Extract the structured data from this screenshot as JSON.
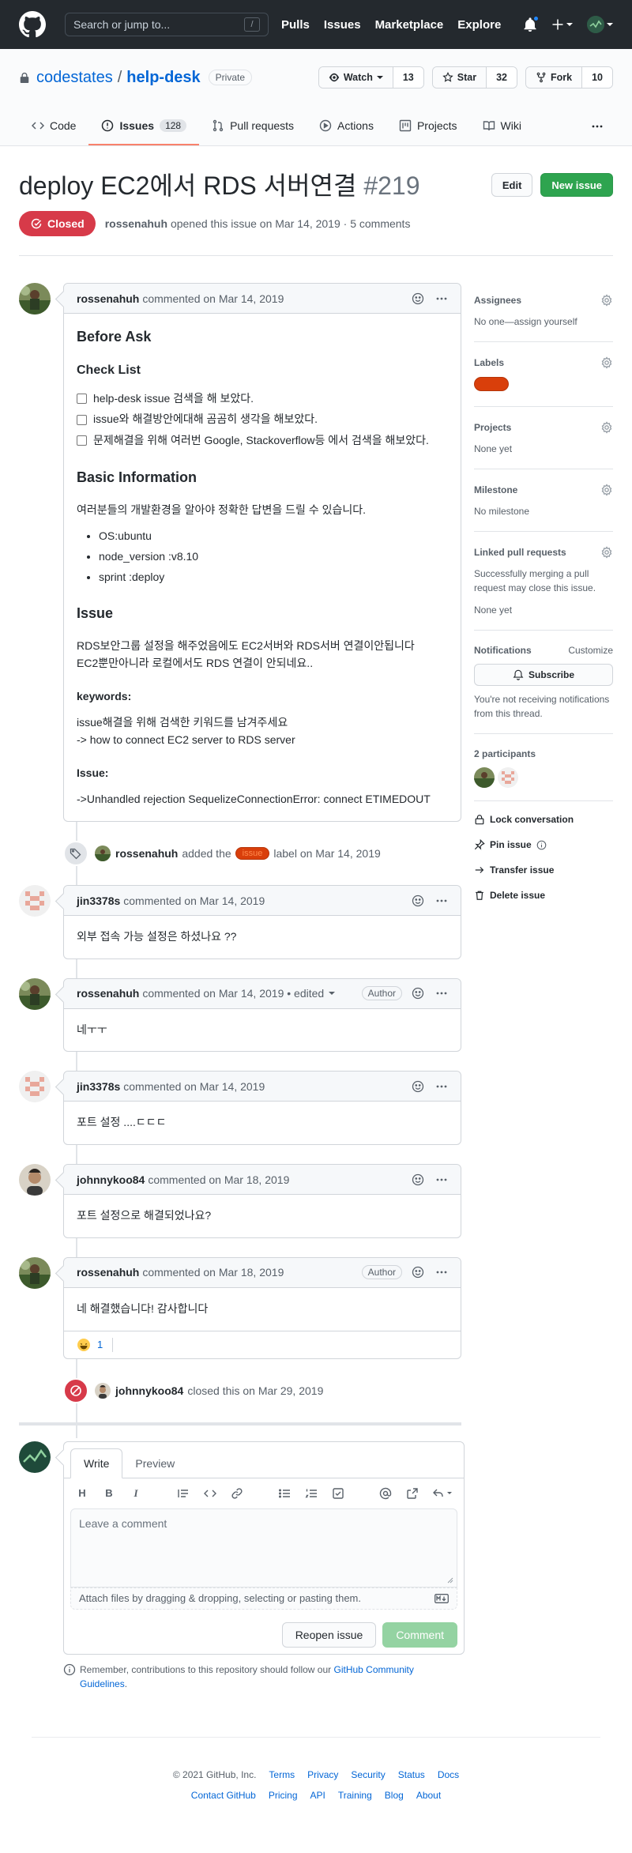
{
  "header": {
    "search_placeholder": "Search or jump to...",
    "slash": "/",
    "nav": [
      "Pulls",
      "Issues",
      "Marketplace",
      "Explore"
    ]
  },
  "repo": {
    "owner": "codestates",
    "sep": "/",
    "name": "help-desk",
    "visibility": "Private",
    "watch_label": "Watch",
    "watch_count": "13",
    "star_label": "Star",
    "star_count": "32",
    "fork_label": "Fork",
    "fork_count": "10",
    "tabs": [
      {
        "label": "Code"
      },
      {
        "label": "Issues",
        "count": "128"
      },
      {
        "label": "Pull requests"
      },
      {
        "label": "Actions"
      },
      {
        "label": "Projects"
      },
      {
        "label": "Wiki"
      }
    ]
  },
  "issue": {
    "title": "deploy EC2에서 RDS 서버연결",
    "number": "#219",
    "edit_label": "Edit",
    "new_issue_label": "New issue",
    "state": "Closed",
    "author": "rossenahuh",
    "meta_text": "opened this issue on Mar 14, 2019 · 5 comments"
  },
  "first_comment": {
    "author": "rossenahuh",
    "meta": "commented on Mar 14, 2019",
    "h_before": "Before Ask",
    "h_checklist": "Check List",
    "checklist": [
      "help-desk issue 검색을 해 보았다.",
      "issue와 해결방안에대해 곰곰히 생각을 해보았다.",
      "문제해결을 위해 여러번 Google, Stackoverflow등 에서 검색을 해보았다."
    ],
    "h_basic": "Basic Information",
    "basic_intro": "여러분들의 개발환경을 알아야 정확한 답변을 드릴 수 있습니다.",
    "env": [
      "OS:ubuntu",
      "node_version :v8.10",
      "sprint :deploy"
    ],
    "h_issue": "Issue",
    "issue_line1": "RDS보안그룹 설정을 해주었음에도 EC2서버와 RDS서버 연결이안됩니다",
    "issue_line2": "EC2뿐만아니라 로컬에서도 RDS 연결이 안되네요..",
    "h_keywords": "keywords:",
    "keywords_line1": "issue해결을 위해 검색한 키워드를 남겨주세요",
    "keywords_line2": "-> how to connect EC2 server to RDS server",
    "h_issue2": "Issue:",
    "error_line": "->Unhandled rejection SequelizeConnectionError: connect ETIMEDOUT"
  },
  "label_event": {
    "who": "rossenahuh",
    "pre": "added the",
    "label": "issue",
    "post": "label on Mar 14, 2019"
  },
  "comments": [
    {
      "author": "jin3378s",
      "meta": "commented on Mar 14, 2019",
      "badge": "",
      "body": "외부 접속 가능 설정은 하셨나요 ??"
    },
    {
      "author": "rossenahuh",
      "meta": "commented on Mar 14, 2019 • edited",
      "badge": "Author",
      "body": "네ㅜㅜ"
    },
    {
      "author": "jin3378s",
      "meta": "commented on Mar 14, 2019",
      "badge": "",
      "body": "포트 설정 ....ㄷㄷㄷ"
    },
    {
      "author": "johnnykoo84",
      "meta": "commented on Mar 18, 2019",
      "badge": "",
      "body": "포트 설정으로 해결되었나요?"
    },
    {
      "author": "rossenahuh",
      "meta": "commented on Mar 18, 2019",
      "badge": "Author",
      "body": "네 해결했습니다! 감사합니다",
      "reaction_count": "1"
    }
  ],
  "close_event": {
    "who": "johnnykoo84",
    "text": "closed this on Mar 29, 2019"
  },
  "form": {
    "tab_write": "Write",
    "tab_preview": "Preview",
    "placeholder": "Leave a comment",
    "attach_text": "Attach files by dragging & dropping, selecting or pasting them.",
    "reopen_label": "Reopen issue",
    "comment_label": "Comment",
    "guidelines_pre": "Remember, contributions to this repository should follow our",
    "guidelines_link": "GitHub Community Guidelines",
    "guidelines_post": "."
  },
  "sidebar": {
    "assignees_title": "Assignees",
    "assignees_text": "No one—assign yourself",
    "labels_title": "Labels",
    "projects_title": "Projects",
    "projects_text": "None yet",
    "milestone_title": "Milestone",
    "milestone_text": "No milestone",
    "linked_title": "Linked pull requests",
    "linked_text": "Successfully merging a pull request may close this issue.",
    "linked_none": "None yet",
    "notifications_title": "Notifications",
    "customize": "Customize",
    "subscribe": "Subscribe",
    "notif_text": "You're not receiving notifications from this thread.",
    "participants_title": "2 participants",
    "lock": "Lock conversation",
    "pin": "Pin issue",
    "transfer": "Transfer issue",
    "delete": "Delete issue"
  },
  "footer": {
    "copyright": "© 2021 GitHub, Inc.",
    "row1": [
      "Terms",
      "Privacy",
      "Security",
      "Status",
      "Docs"
    ],
    "row2": [
      "Contact GitHub",
      "Pricing",
      "API",
      "Training",
      "Blog",
      "About"
    ]
  },
  "colors": {
    "header_bg": "#24292e",
    "closed_red": "#d73a49",
    "primary_green": "#2ea44f",
    "link_blue": "#0366d6",
    "label_orange": "#d93f0b"
  }
}
